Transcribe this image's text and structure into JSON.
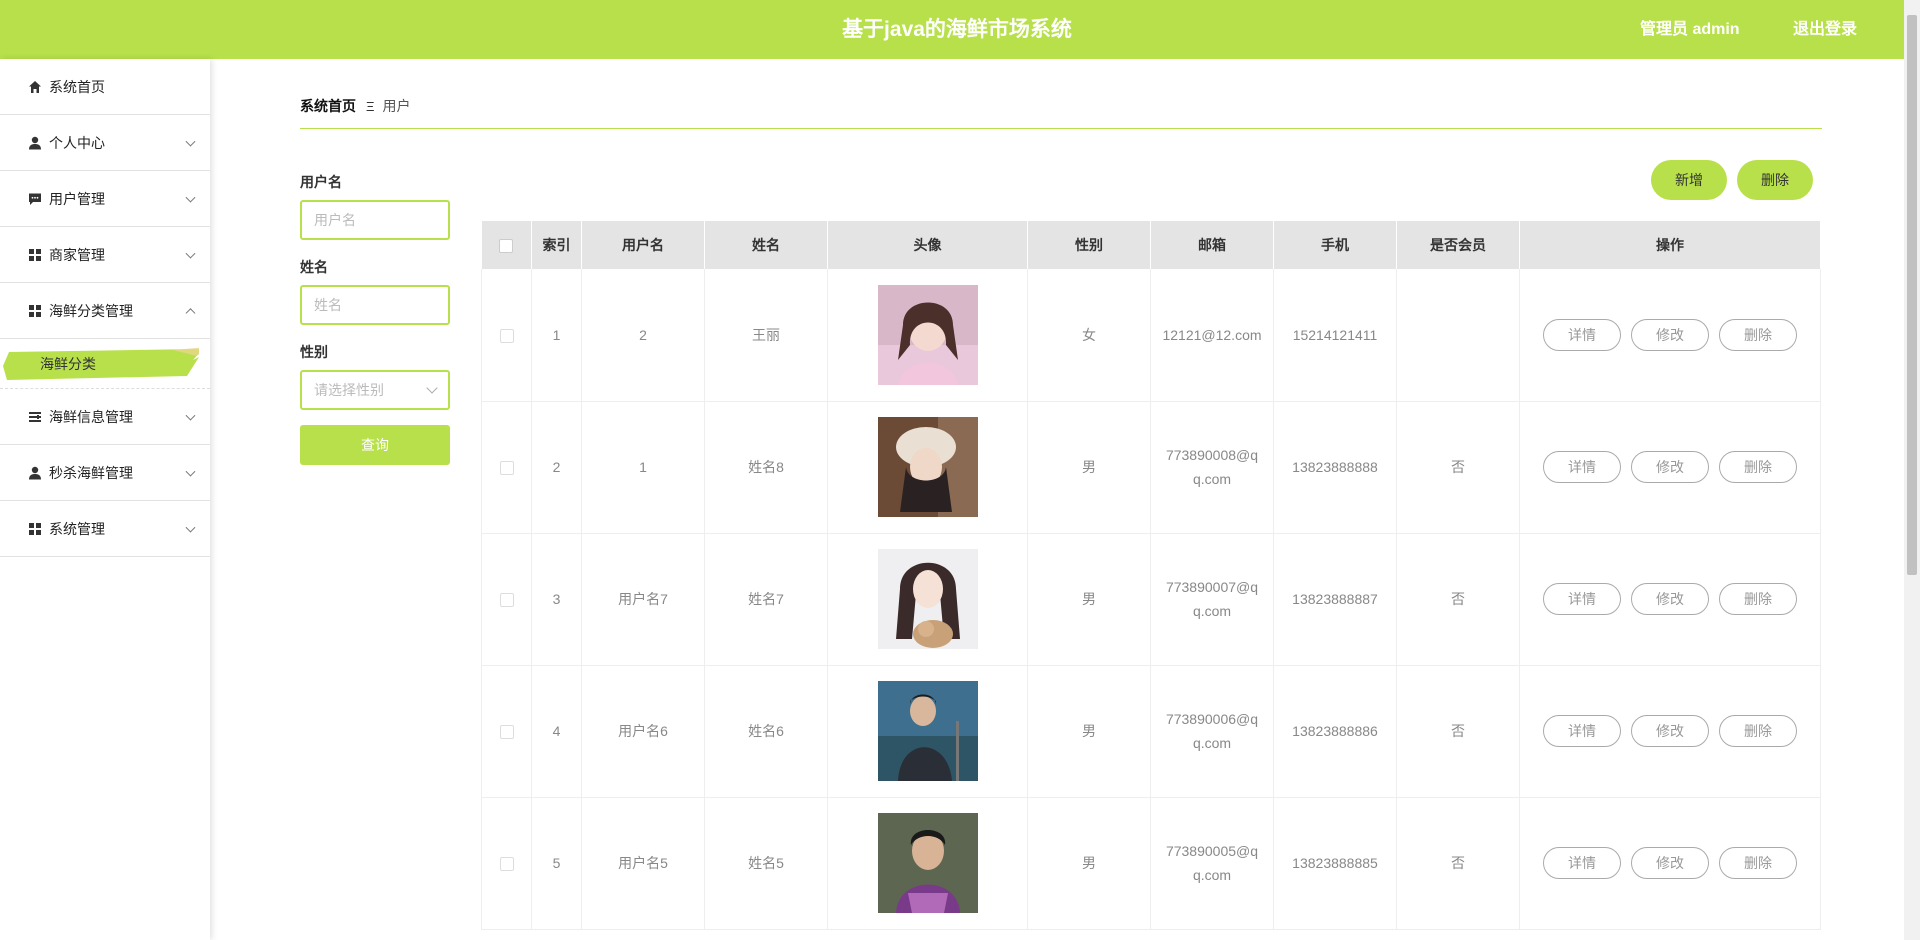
{
  "header": {
    "title": "基于java的海鲜市场系统",
    "user": "管理员 admin",
    "logout": "退出登录"
  },
  "sidebar": {
    "items": [
      {
        "label": "系统首页",
        "icon": "home-icon"
      },
      {
        "label": "个人中心",
        "icon": "person-icon"
      },
      {
        "label": "用户管理",
        "icon": "chat-icon"
      },
      {
        "label": "商家管理",
        "icon": "grid-icon"
      },
      {
        "label": "海鲜分类管理",
        "icon": "grid-icon"
      },
      {
        "label": "海鲜信息管理",
        "icon": "list-icon"
      },
      {
        "label": "秒杀海鲜管理",
        "icon": "person-icon"
      },
      {
        "label": "系统管理",
        "icon": "grid-icon"
      }
    ],
    "active_sub": "海鲜分类"
  },
  "breadcrumb": {
    "home": "系统首页",
    "separator": "Ξ",
    "current": "用户"
  },
  "filters": {
    "username_label": "用户名",
    "username_placeholder": "用户名",
    "name_label": "姓名",
    "name_placeholder": "姓名",
    "gender_label": "性别",
    "gender_placeholder": "请选择性别",
    "query": "查询"
  },
  "actions": {
    "add": "新增",
    "delete": "删除"
  },
  "table": {
    "headers": [
      "索引",
      "用户名",
      "姓名",
      "头像",
      "性别",
      "邮箱",
      "手机",
      "是否会员",
      "操作"
    ],
    "row_buttons": [
      "详情",
      "修改",
      "删除"
    ],
    "rows": [
      {
        "index": "1",
        "username": "2",
        "name": "王丽",
        "gender": "女",
        "email": "12121@12.com",
        "phone": "15214121411",
        "member": ""
      },
      {
        "index": "2",
        "username": "1",
        "name": "姓名8",
        "gender": "男",
        "email": "773890008@qq.com",
        "phone": "13823888888",
        "member": "否"
      },
      {
        "index": "3",
        "username": "用户名7",
        "name": "姓名7",
        "gender": "男",
        "email": "773890007@qq.com",
        "phone": "13823888887",
        "member": "否"
      },
      {
        "index": "4",
        "username": "用户名6",
        "name": "姓名6",
        "gender": "男",
        "email": "773890006@qq.com",
        "phone": "13823888886",
        "member": "否"
      },
      {
        "index": "5",
        "username": "用户名5",
        "name": "姓名5",
        "gender": "男",
        "email": "773890005@qq.com",
        "phone": "13823888885",
        "member": "否"
      }
    ]
  },
  "colors": {
    "accent": "#b8e04b",
    "header_bg": "#e4e4e4"
  }
}
